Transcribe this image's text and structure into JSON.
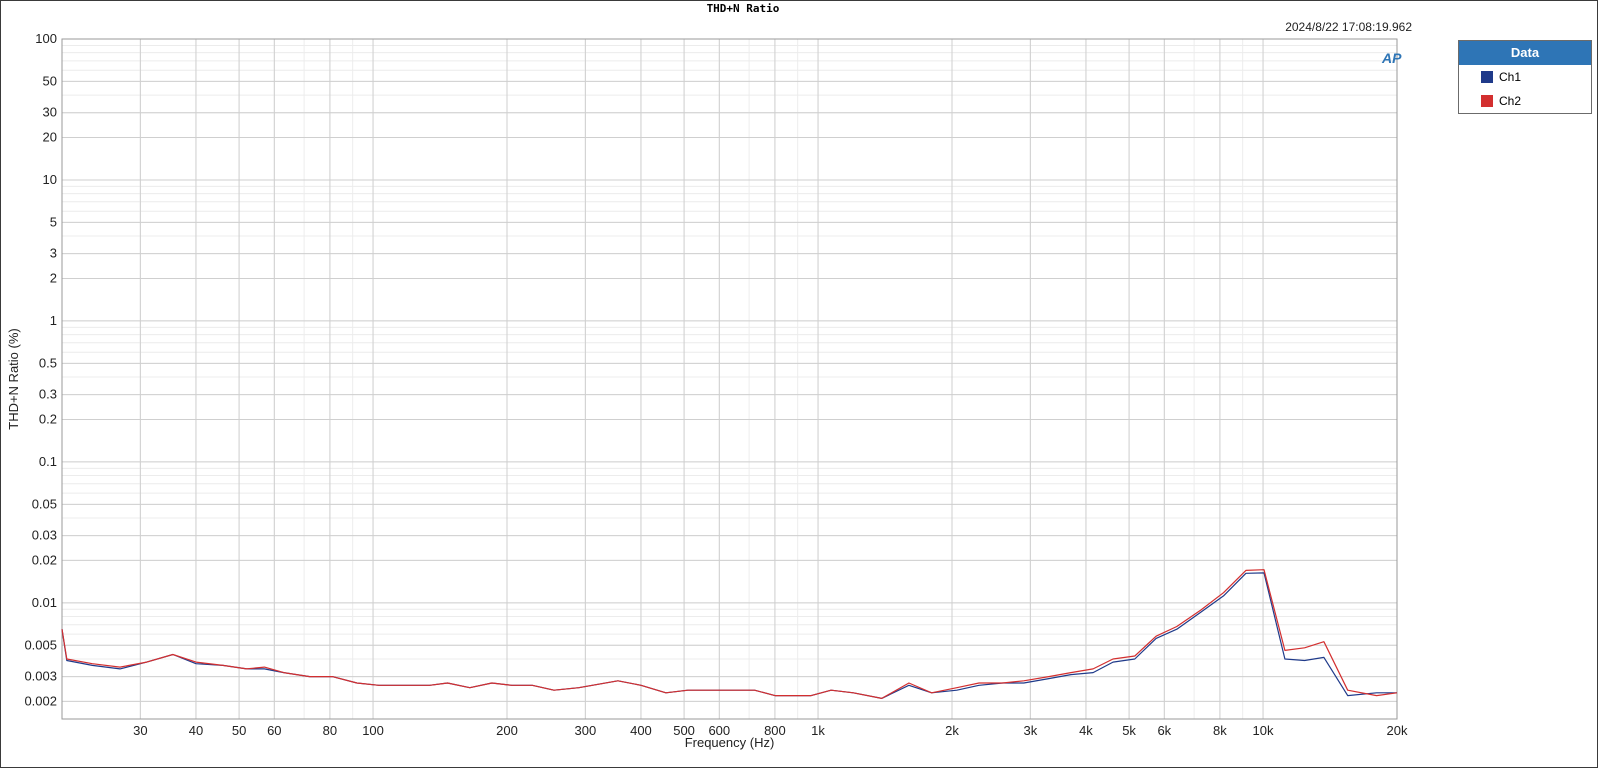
{
  "header": {
    "title": "THD+N Ratio",
    "timestamp": "2024/8/22 17:08:19.962"
  },
  "legend": {
    "title": "Data",
    "items": [
      {
        "label": "Ch1",
        "color": "#1f3a8a"
      },
      {
        "label": "Ch2",
        "color": "#d32f2f"
      }
    ]
  },
  "logo": {
    "text": "AP",
    "icon": "ap-logo-icon"
  },
  "chart_data": {
    "type": "line",
    "title": "THD+N Ratio",
    "xlabel": "Frequency (Hz)",
    "ylabel": "THD+N Ratio (%)",
    "xscale": "log",
    "yscale": "log",
    "xlim": [
      20,
      20000
    ],
    "ylim": [
      0.0015,
      100
    ],
    "grid": true,
    "legend_position": "right",
    "x_ticks": [
      {
        "v": 30,
        "l": "30"
      },
      {
        "v": 40,
        "l": "40"
      },
      {
        "v": 50,
        "l": "50"
      },
      {
        "v": 60,
        "l": "60"
      },
      {
        "v": 80,
        "l": "80"
      },
      {
        "v": 100,
        "l": "100"
      },
      {
        "v": 200,
        "l": "200"
      },
      {
        "v": 300,
        "l": "300"
      },
      {
        "v": 400,
        "l": "400"
      },
      {
        "v": 500,
        "l": "500"
      },
      {
        "v": 600,
        "l": "600"
      },
      {
        "v": 800,
        "l": "800"
      },
      {
        "v": 1000,
        "l": "1k"
      },
      {
        "v": 2000,
        "l": "2k"
      },
      {
        "v": 3000,
        "l": "3k"
      },
      {
        "v": 4000,
        "l": "4k"
      },
      {
        "v": 5000,
        "l": "5k"
      },
      {
        "v": 6000,
        "l": "6k"
      },
      {
        "v": 8000,
        "l": "8k"
      },
      {
        "v": 10000,
        "l": "10k"
      },
      {
        "v": 20000,
        "l": "20k"
      }
    ],
    "y_ticks": [
      {
        "v": 100,
        "l": "100"
      },
      {
        "v": 50,
        "l": "50"
      },
      {
        "v": 30,
        "l": "30"
      },
      {
        "v": 20,
        "l": "20"
      },
      {
        "v": 10,
        "l": "10"
      },
      {
        "v": 5,
        "l": "5"
      },
      {
        "v": 3,
        "l": "3"
      },
      {
        "v": 2,
        "l": "2"
      },
      {
        "v": 1,
        "l": "1"
      },
      {
        "v": 0.5,
        "l": "0.5"
      },
      {
        "v": 0.3,
        "l": "0.3"
      },
      {
        "v": 0.2,
        "l": "0.2"
      },
      {
        "v": 0.1,
        "l": "0.1"
      },
      {
        "v": 0.05,
        "l": "0.05"
      },
      {
        "v": 0.03,
        "l": "0.03"
      },
      {
        "v": 0.02,
        "l": "0.02"
      },
      {
        "v": 0.01,
        "l": "0.01"
      },
      {
        "v": 0.005,
        "l": "0.005"
      },
      {
        "v": 0.003,
        "l": "0.003"
      },
      {
        "v": 0.002,
        "l": "0.002"
      }
    ],
    "series": [
      {
        "name": "Ch1",
        "color": "#1f3a8a",
        "points": [
          [
            20,
            0.0065
          ],
          [
            20.5,
            0.0039
          ],
          [
            23.4,
            0.0036
          ],
          [
            27,
            0.0034
          ],
          [
            31,
            0.0038
          ],
          [
            35.5,
            0.0043
          ],
          [
            40,
            0.0037
          ],
          [
            46,
            0.0036
          ],
          [
            52,
            0.0034
          ],
          [
            57,
            0.0034
          ],
          [
            63,
            0.0032
          ],
          [
            72,
            0.003
          ],
          [
            81,
            0.003
          ],
          [
            92,
            0.0027
          ],
          [
            103,
            0.0026
          ],
          [
            118,
            0.0026
          ],
          [
            134,
            0.0026
          ],
          [
            147,
            0.0027
          ],
          [
            165,
            0.0025
          ],
          [
            185,
            0.0027
          ],
          [
            205,
            0.0026
          ],
          [
            228,
            0.0026
          ],
          [
            255,
            0.0024
          ],
          [
            290,
            0.0025
          ],
          [
            355,
            0.0028
          ],
          [
            400,
            0.0026
          ],
          [
            455,
            0.0023
          ],
          [
            510,
            0.0024
          ],
          [
            575,
            0.0024
          ],
          [
            640,
            0.0024
          ],
          [
            720,
            0.0024
          ],
          [
            800,
            0.0022
          ],
          [
            880,
            0.0022
          ],
          [
            965,
            0.0022
          ],
          [
            1070,
            0.0024
          ],
          [
            1200,
            0.0023
          ],
          [
            1390,
            0.0021
          ],
          [
            1600,
            0.0026
          ],
          [
            1800,
            0.0023
          ],
          [
            2050,
            0.0024
          ],
          [
            2300,
            0.0026
          ],
          [
            2600,
            0.0027
          ],
          [
            2900,
            0.0027
          ],
          [
            3300,
            0.0029
          ],
          [
            3700,
            0.0031
          ],
          [
            4150,
            0.0032
          ],
          [
            4600,
            0.0038
          ],
          [
            5150,
            0.004
          ],
          [
            5750,
            0.0056
          ],
          [
            6400,
            0.0065
          ],
          [
            7250,
            0.0086
          ],
          [
            8150,
            0.0112
          ],
          [
            9150,
            0.0162
          ],
          [
            10050,
            0.0163
          ],
          [
            11200,
            0.004
          ],
          [
            12400,
            0.0039
          ],
          [
            13700,
            0.0041
          ],
          [
            15500,
            0.0022
          ],
          [
            18000,
            0.0023
          ],
          [
            20000,
            0.0023
          ]
        ]
      },
      {
        "name": "Ch2",
        "color": "#d32f2f",
        "points": [
          [
            20,
            0.0065
          ],
          [
            20.5,
            0.004
          ],
          [
            23.4,
            0.0037
          ],
          [
            27,
            0.0035
          ],
          [
            31,
            0.0038
          ],
          [
            35.5,
            0.0043
          ],
          [
            40,
            0.0038
          ],
          [
            46,
            0.0036
          ],
          [
            52,
            0.0034
          ],
          [
            57,
            0.0035
          ],
          [
            63,
            0.0032
          ],
          [
            72,
            0.003
          ],
          [
            81,
            0.003
          ],
          [
            92,
            0.0027
          ],
          [
            103,
            0.0026
          ],
          [
            118,
            0.0026
          ],
          [
            134,
            0.0026
          ],
          [
            147,
            0.0027
          ],
          [
            165,
            0.0025
          ],
          [
            185,
            0.0027
          ],
          [
            205,
            0.0026
          ],
          [
            228,
            0.0026
          ],
          [
            255,
            0.0024
          ],
          [
            290,
            0.0025
          ],
          [
            355,
            0.0028
          ],
          [
            400,
            0.0026
          ],
          [
            455,
            0.0023
          ],
          [
            510,
            0.0024
          ],
          [
            575,
            0.0024
          ],
          [
            640,
            0.0024
          ],
          [
            720,
            0.0024
          ],
          [
            800,
            0.0022
          ],
          [
            880,
            0.0022
          ],
          [
            965,
            0.0022
          ],
          [
            1070,
            0.0024
          ],
          [
            1200,
            0.0023
          ],
          [
            1390,
            0.0021
          ],
          [
            1600,
            0.0027
          ],
          [
            1800,
            0.0023
          ],
          [
            2050,
            0.0025
          ],
          [
            2300,
            0.0027
          ],
          [
            2600,
            0.0027
          ],
          [
            2900,
            0.0028
          ],
          [
            3300,
            0.003
          ],
          [
            3700,
            0.0032
          ],
          [
            4150,
            0.0034
          ],
          [
            4600,
            0.004
          ],
          [
            5150,
            0.0042
          ],
          [
            5750,
            0.0058
          ],
          [
            6400,
            0.0068
          ],
          [
            7250,
            0.0089
          ],
          [
            8150,
            0.0118
          ],
          [
            9150,
            0.017
          ],
          [
            10050,
            0.0172
          ],
          [
            11200,
            0.0046
          ],
          [
            12400,
            0.0048
          ],
          [
            13700,
            0.0053
          ],
          [
            15500,
            0.0024
          ],
          [
            18000,
            0.0022
          ],
          [
            20000,
            0.0023
          ]
        ]
      }
    ]
  }
}
